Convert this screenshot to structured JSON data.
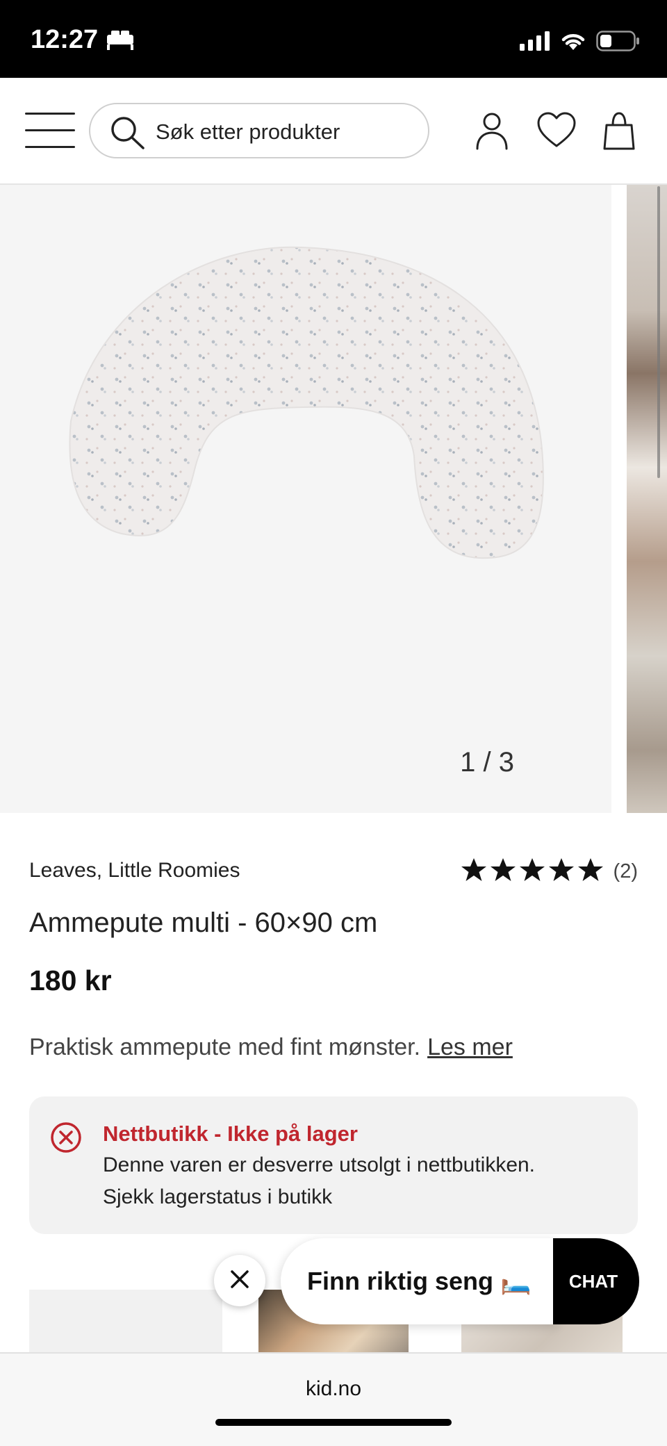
{
  "status_bar": {
    "time": "12:27"
  },
  "header": {
    "search_placeholder": "Søk etter produkter"
  },
  "gallery": {
    "counter": "1 / 3"
  },
  "product": {
    "brand": "Leaves, Little Roomies",
    "rating_stars": 5,
    "rating_count": "(2)",
    "title": "Ammepute multi - 60×90 cm",
    "price": "180 kr",
    "description": "Praktisk ammepute med fint mønster.",
    "read_more": "Les mer"
  },
  "stock": {
    "title": "Nettbutikk - Ikke på lager",
    "line1": "Denne varen er desverre utsolgt i nettbutikken.",
    "line2": "Sjekk lagerstatus i butikk"
  },
  "chat_widget": {
    "promo_text": "Finn riktig seng 🛏️",
    "chat_label": "CHAT"
  },
  "browser": {
    "url": "kid.no"
  },
  "colors": {
    "error_red": "#c0262e",
    "chat_black": "#000000",
    "star_black": "#111111"
  }
}
